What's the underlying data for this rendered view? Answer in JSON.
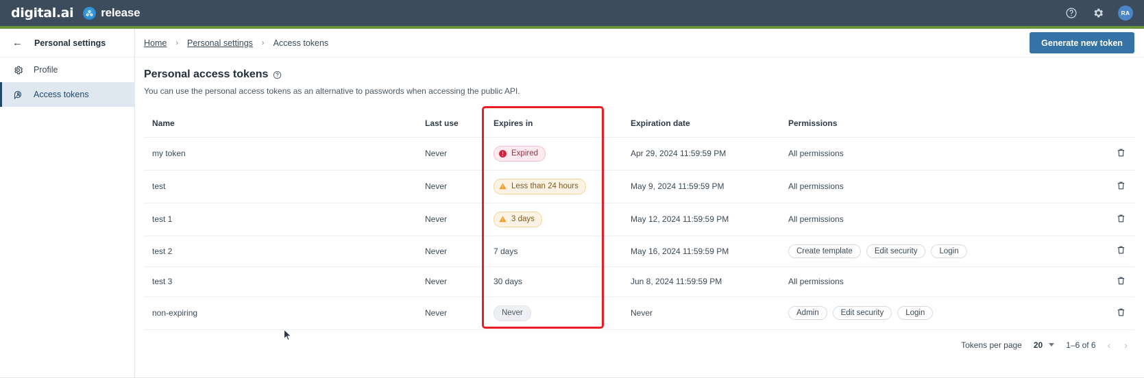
{
  "topbar": {
    "brand_primary": "digital.ai",
    "brand_secondary": "release",
    "help_icon": "help-circle-icon",
    "settings_icon": "gear-icon",
    "avatar_initials": "RA"
  },
  "sidebar": {
    "back_icon": "back-arrow-icon",
    "title": "Personal settings",
    "items": [
      {
        "label": "Profile",
        "icon": "gear-icon",
        "active": false
      },
      {
        "label": "Access tokens",
        "icon": "user-key-icon",
        "active": true
      }
    ]
  },
  "breadcrumb": {
    "items": [
      "Home",
      "Personal settings",
      "Access tokens"
    ],
    "separator": "›"
  },
  "actions": {
    "generate_label": "Generate new token"
  },
  "page": {
    "title": "Personal access tokens",
    "help_icon": "help-circle-icon",
    "subtitle": "You can use the personal access tokens as an alternative to passwords when accessing the public API."
  },
  "table": {
    "columns": [
      "Name",
      "Last use",
      "Expires in",
      "Expiration date",
      "Permissions",
      ""
    ],
    "delete_icon": "trash-icon",
    "rows": [
      {
        "name": "my token",
        "last_use": "Never",
        "expires_in": {
          "text": "Expired",
          "style": "expired",
          "icon": "error-circle-icon"
        },
        "expiration_date": "Apr 29, 2024 11:59:59 PM",
        "permissions_text": "All permissions",
        "permissions_chips": []
      },
      {
        "name": "test",
        "last_use": "Never",
        "expires_in": {
          "text": "Less than 24 hours",
          "style": "warn",
          "icon": "warning-triangle-icon"
        },
        "expiration_date": "May 9, 2024 11:59:59 PM",
        "permissions_text": "All permissions",
        "permissions_chips": []
      },
      {
        "name": "test 1",
        "last_use": "Never",
        "expires_in": {
          "text": "3 days",
          "style": "warn",
          "icon": "warning-triangle-icon"
        },
        "expiration_date": "May 12, 2024 11:59:59 PM",
        "permissions_text": "All permissions",
        "permissions_chips": []
      },
      {
        "name": "test 2",
        "last_use": "Never",
        "expires_in": {
          "text": "7 days",
          "style": "plain",
          "icon": ""
        },
        "expiration_date": "May 16, 2024 11:59:59 PM",
        "permissions_text": "",
        "permissions_chips": [
          "Create template",
          "Edit security",
          "Login"
        ]
      },
      {
        "name": "test 3",
        "last_use": "Never",
        "expires_in": {
          "text": "30 days",
          "style": "plain",
          "icon": ""
        },
        "expiration_date": "Jun 8, 2024 11:59:59 PM",
        "permissions_text": "All permissions",
        "permissions_chips": []
      },
      {
        "name": "non-expiring",
        "last_use": "Never",
        "expires_in": {
          "text": "Never",
          "style": "neutral",
          "icon": ""
        },
        "expiration_date": "Never",
        "permissions_text": "",
        "permissions_chips": [
          "Admin",
          "Edit security",
          "Login"
        ]
      }
    ]
  },
  "pagination": {
    "per_page_label": "Tokens per page",
    "per_page_value": "20",
    "range": "1–6 of 6",
    "prev": "‹",
    "next": "›"
  },
  "annotation": {
    "color": "#ec1c24",
    "target_column": "Expires in"
  }
}
